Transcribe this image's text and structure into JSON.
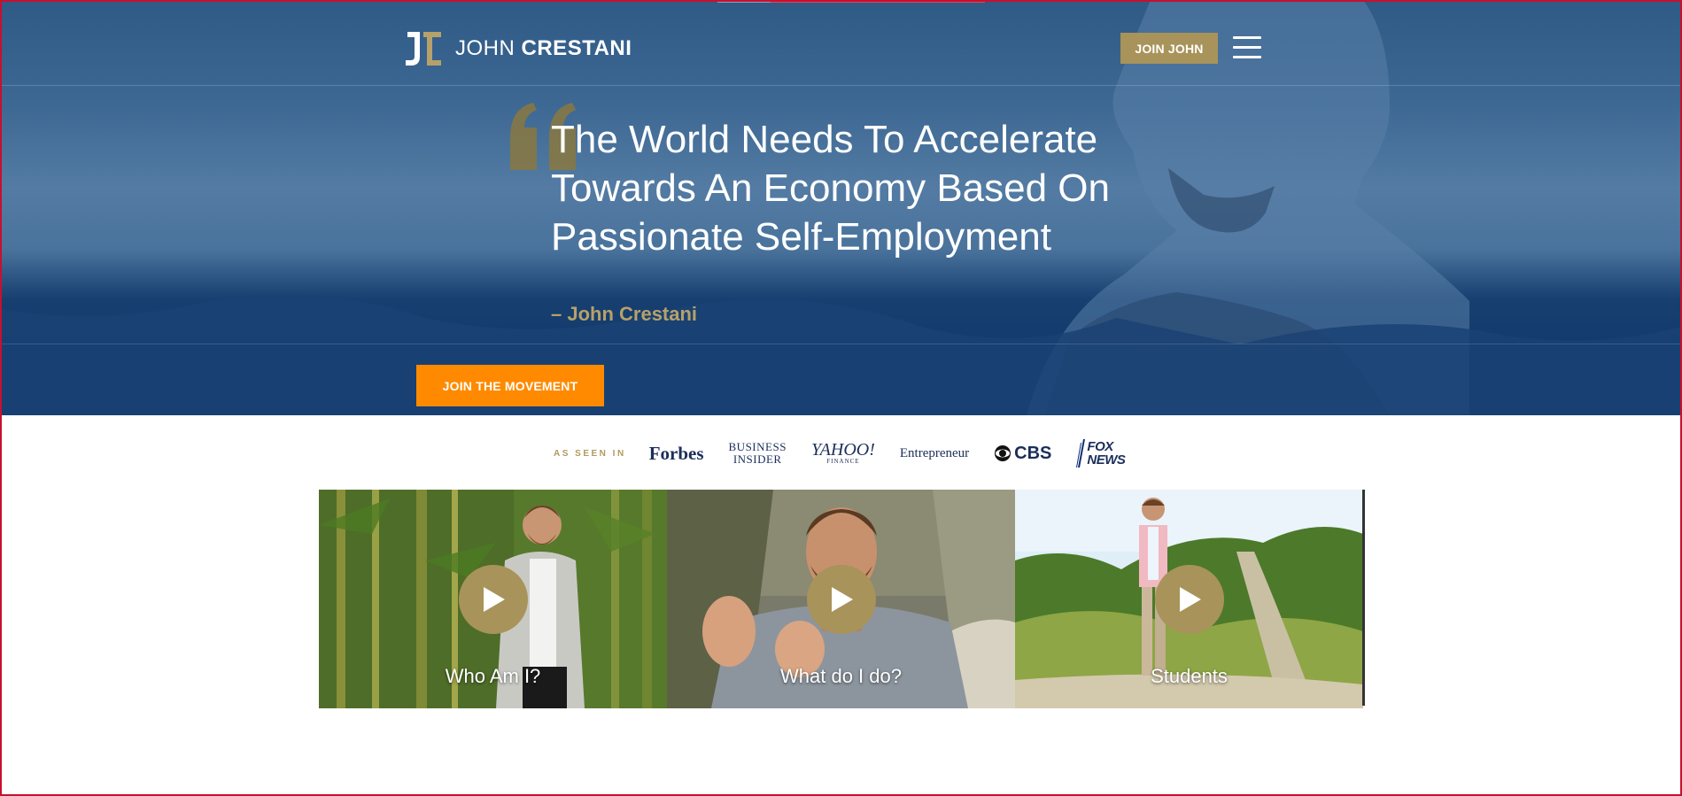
{
  "header": {
    "logo_first": "JOHN",
    "logo_last": "CRESTANI",
    "join_label": "JOIN JOHN",
    "menu_icon": "hamburger-menu-icon"
  },
  "hero": {
    "quote_line1": "The World Needs To Accelerate",
    "quote_line2": "Towards An Economy Based On",
    "quote_line3": "Passionate Self-Employment",
    "author": "– John Crestani",
    "cta_label": "JOIN THE MOVEMENT"
  },
  "press": {
    "label": "AS SEEN IN",
    "forbes": "Forbes",
    "business_insider_line1": "BUSINESS",
    "business_insider_line2": "INSIDER",
    "yahoo": "YAHOO!",
    "yahoo_sub": "FINANCE",
    "entrepreneur": "Entrepreneur",
    "cbs": "CBS",
    "fox_line1": "FOX",
    "fox_line2": "NEWS"
  },
  "videos": [
    {
      "caption": "Who Am I?"
    },
    {
      "caption": "What do I do?"
    },
    {
      "caption": "Students"
    }
  ],
  "colors": {
    "gold": "#a8935a",
    "orange": "#ff8a00",
    "navy": "#0f3467",
    "border_red": "#c8102e"
  }
}
